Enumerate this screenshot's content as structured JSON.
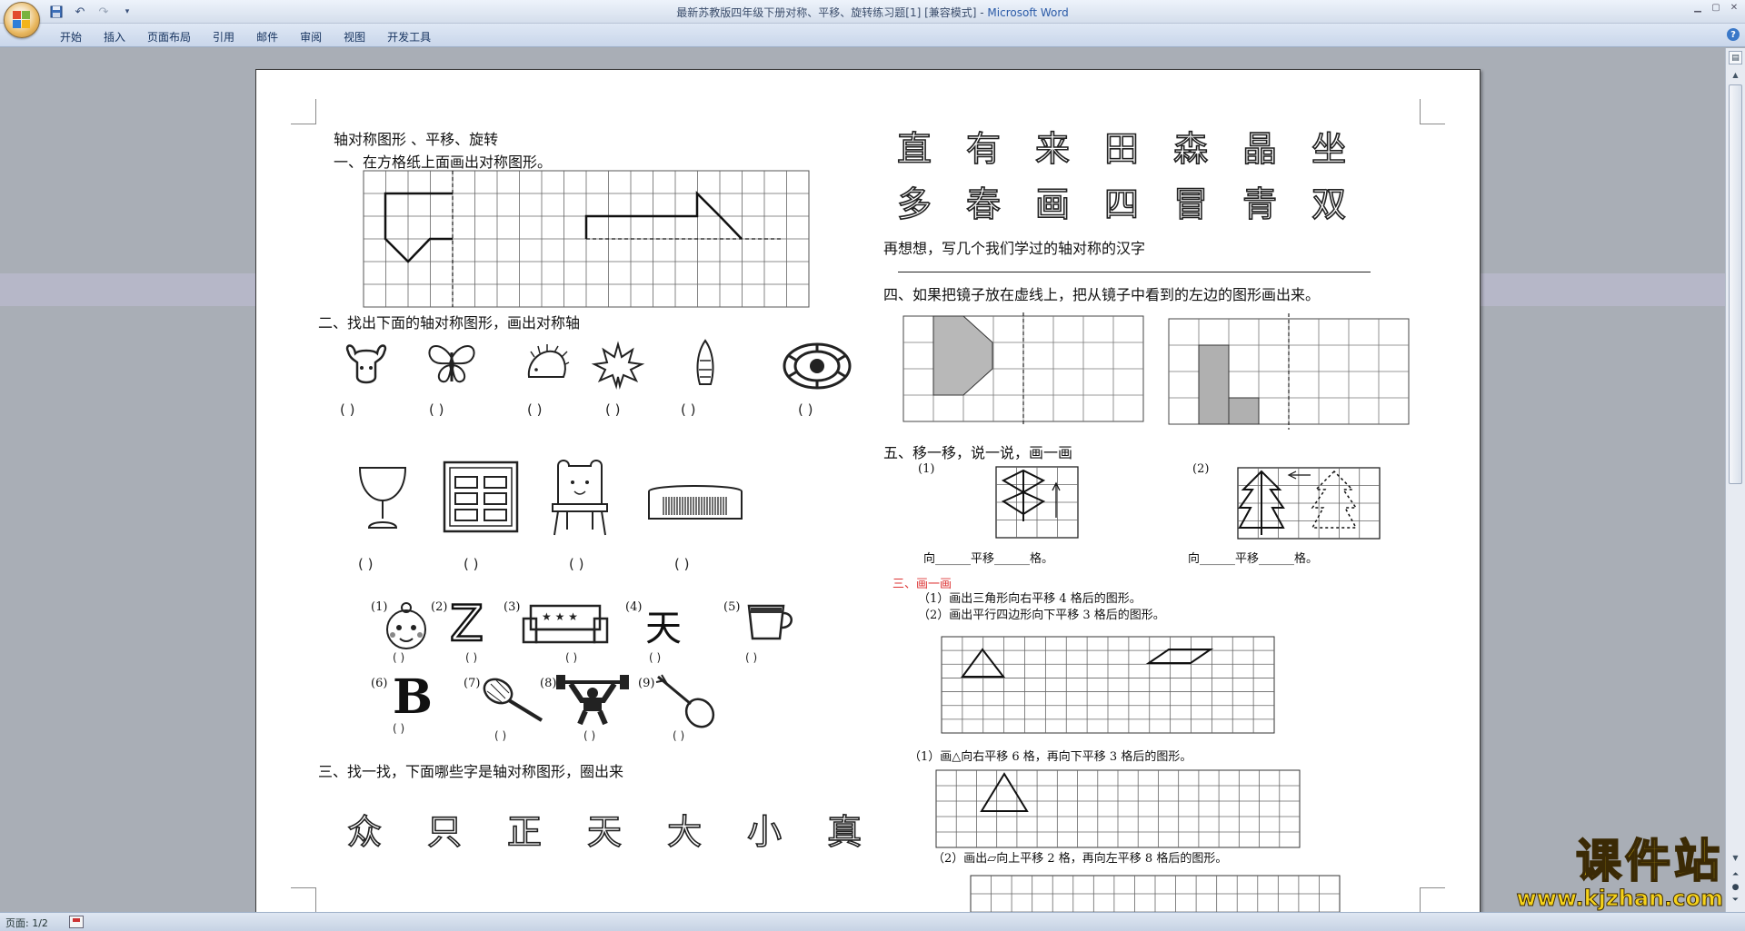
{
  "window": {
    "title": "最新苏教版四年级下册对称、平移、旋转练习题[1] [兼容模式] - ",
    "app_name": "Microsoft Word"
  },
  "quick_access": {
    "save_icon": "save-icon",
    "undo_icon": "undo-icon",
    "redo_icon": "redo-icon",
    "customize_icon": "dropdown-icon"
  },
  "ribbon": {
    "tabs": [
      "开始",
      "插入",
      "页面布局",
      "引用",
      "邮件",
      "审阅",
      "视图",
      "开发工具"
    ]
  },
  "status": {
    "page": "页面: 1/2"
  },
  "watermark": {
    "title": "课件站",
    "url": "www.kjzhan.com"
  },
  "doc": {
    "left": {
      "title": "轴对称图形 、平移、旋转",
      "q1": "一、在方格纸上面画出对称图形。",
      "q2": "二、找出下面的轴对称图形，画出对称轴",
      "paren": "(      )",
      "paren_small": "(    )",
      "q3": "三、找一找，下面哪些字是轴对称图形，圈出来",
      "q3_chars": [
        "众",
        "只",
        "正",
        "天",
        "大",
        "小",
        "真"
      ],
      "items3_labels": [
        "(1)",
        "(2)",
        "(3)",
        "(4)",
        "(5)",
        "(6)",
        "(7)",
        "(8)",
        "(9)"
      ],
      "letter_z": "Z",
      "letter_b": "B",
      "char_tian": "天"
    },
    "right": {
      "chars_row1": [
        "直",
        "有",
        "来",
        "田",
        "森",
        "晶",
        "坐"
      ],
      "chars_row2": [
        "多",
        "春",
        "画",
        "四",
        "冒",
        "青",
        "双"
      ],
      "think": "再想想，写几个我们学过的轴对称的汉字",
      "q4": "四、如果把镜子放在虚线上，把从镜子中看到的左边的图形画出来。",
      "q5": "五、移一移，说一说，画一画",
      "q5_1": "(1)",
      "q5_2": "(2)",
      "fill_line": "向______平移______格。",
      "draw_heading": "三、画一画",
      "draw_1": "（1）画出三角形向右平移 4 格后的图形。",
      "draw_2": "（2）画出平行四边形向下平移 3 格后的图形。",
      "draw_3": "（1）画△向右平移 6 格，再向下平移 3 格后的图形。",
      "draw_4": "（2）画出▱向上平移 2 格，再向左平移 8 格后的图形。"
    }
  }
}
